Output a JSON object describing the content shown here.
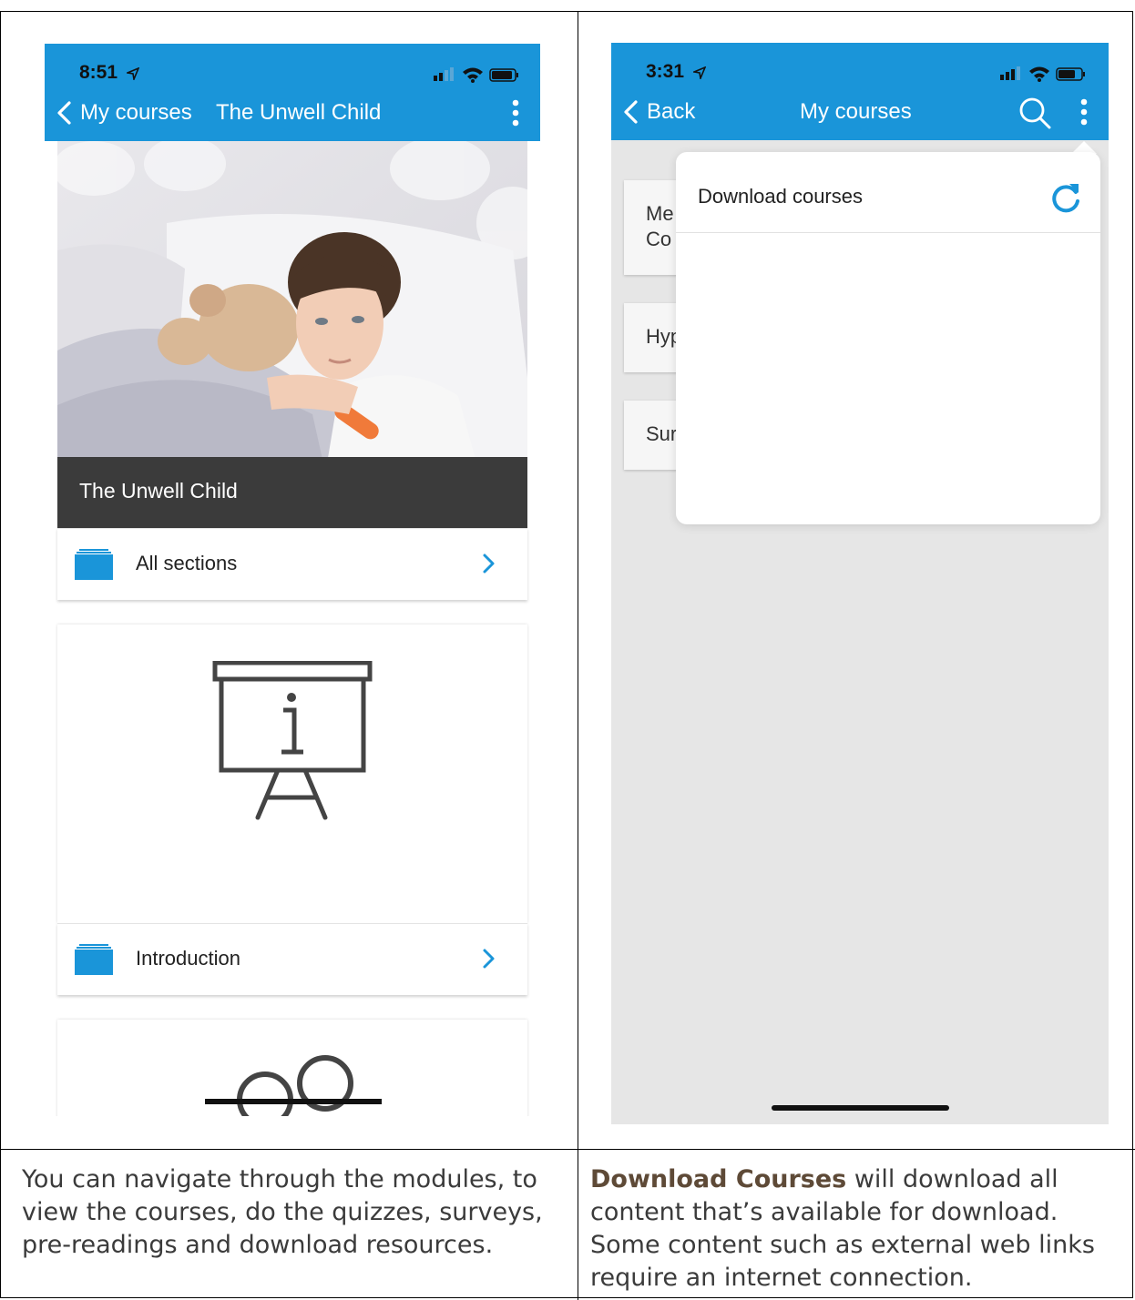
{
  "left_screen": {
    "status_time": "8:51",
    "nav": {
      "back_label": "My courses",
      "title": "The Unwell Child"
    },
    "course_card": {
      "title": "The Unwell Child",
      "row_label": "All sections"
    },
    "section_card": {
      "row_label": "Introduction"
    }
  },
  "right_screen": {
    "status_time": "3:31",
    "nav": {
      "back_label": "Back",
      "title": "My courses"
    },
    "background_cards": [
      {
        "line1": "Me",
        "line2": "Co"
      },
      {
        "line1": "Hyp"
      },
      {
        "line1": "Sur"
      }
    ],
    "menu": {
      "item_label": "Download courses"
    }
  },
  "captions": {
    "left": "You can navigate through the modules, to view the courses, do the quizzes, surveys, pre-readings and download resources.",
    "right_bold": "Download Courses",
    "right_rest": " will download all content that’s available for download. Some content such as external web links require an internet connection."
  },
  "colors": {
    "app_bar": "#1a95d9",
    "title_band": "#3b3b3b",
    "folder_icon": "#1a95d9",
    "refresh_icon": "#1a95d9",
    "bold_caption": "#5e4a37"
  }
}
